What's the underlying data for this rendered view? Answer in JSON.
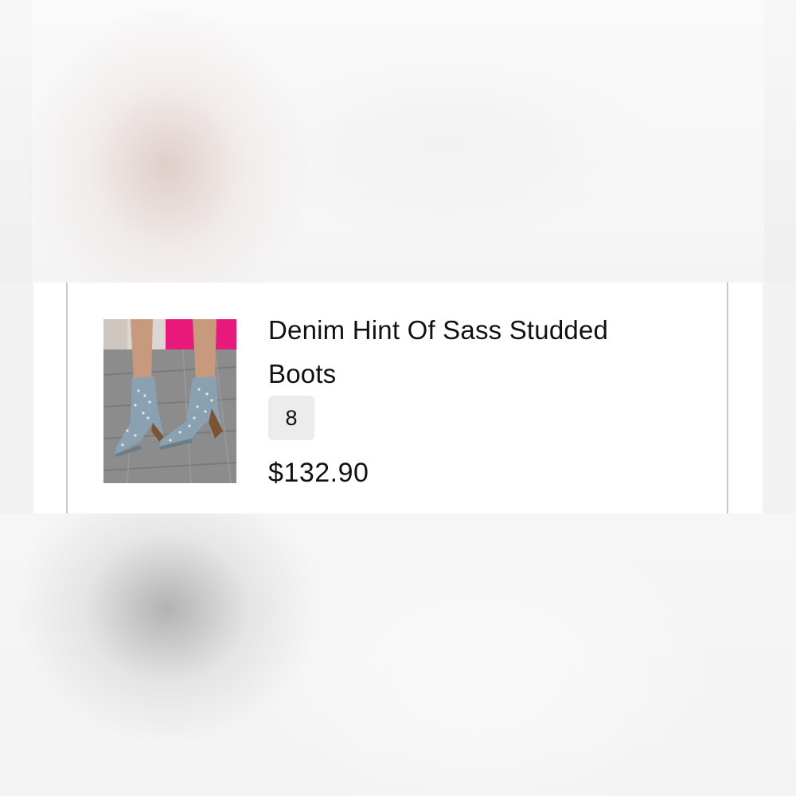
{
  "cart_item": {
    "title": "Denim Hint Of Sass Studded Boots",
    "size": "8",
    "price": "$132.90",
    "image_icon": "product-photo-studded-ankle-boots"
  },
  "colors": {
    "background": "#f4f4f4",
    "card": "#ffffff",
    "border": "#c9c9c9",
    "badge": "#ececec",
    "text": "#111111",
    "boot_denim": "#8aa1b1",
    "accent_pink": "#e8197a"
  }
}
